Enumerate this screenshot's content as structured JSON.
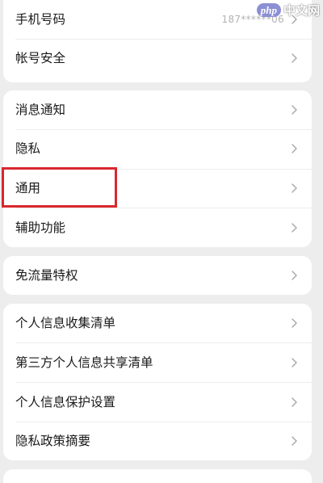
{
  "accent_colors": {
    "highlight_border": "#d9272e",
    "watermark_badge": "#8b8fd4"
  },
  "watermark": {
    "logo_text": "php",
    "site_text": "中文网"
  },
  "groups": [
    {
      "items": [
        {
          "label": "手机号码",
          "value": "187******06",
          "icon": "chevron-right-icon"
        },
        {
          "label": "帐号安全",
          "icon": "chevron-right-icon"
        }
      ]
    },
    {
      "items": [
        {
          "label": "消息通知",
          "icon": "chevron-right-icon"
        },
        {
          "label": "隐私",
          "icon": "chevron-right-icon"
        },
        {
          "label": "通用",
          "icon": "chevron-right-icon",
          "highlighted": true
        },
        {
          "label": "辅助功能",
          "icon": "chevron-right-icon"
        }
      ]
    },
    {
      "items": [
        {
          "label": "免流量特权",
          "icon": "chevron-right-icon"
        }
      ]
    },
    {
      "items": [
        {
          "label": "个人信息收集清单",
          "icon": "chevron-right-icon"
        },
        {
          "label": "第三方个人信息共享清单",
          "icon": "chevron-right-icon"
        },
        {
          "label": "个人信息保护设置",
          "icon": "chevron-right-icon"
        },
        {
          "label": "隐私政策摘要",
          "icon": "chevron-right-icon"
        }
      ]
    }
  ]
}
